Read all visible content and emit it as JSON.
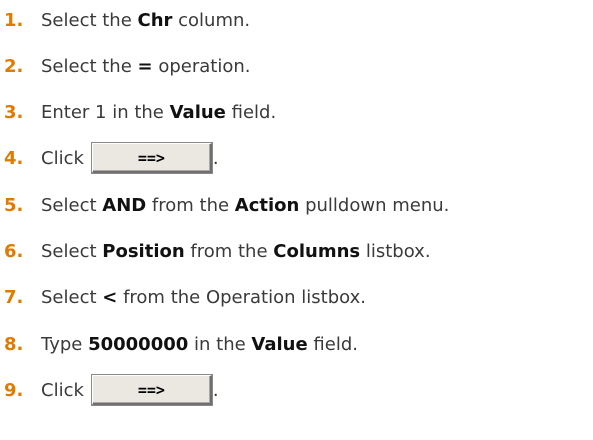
{
  "steps": [
    {
      "num": "1.",
      "parts": [
        {
          "t": "Select the "
        },
        {
          "t": "Chr",
          "b": true
        },
        {
          "t": " column."
        }
      ]
    },
    {
      "num": "2.",
      "parts": [
        {
          "t": "Select the "
        },
        {
          "t": "=",
          "b": true
        },
        {
          "t": " operation."
        }
      ]
    },
    {
      "num": "3.",
      "parts": [
        {
          "t": "Enter 1 in the "
        },
        {
          "t": "Value",
          "b": true
        },
        {
          "t": " field."
        }
      ]
    },
    {
      "num": "4.",
      "parts": [
        {
          "t": "Click"
        }
      ],
      "button": "==>",
      "after": "."
    },
    {
      "num": "5.",
      "parts": [
        {
          "t": "Select "
        },
        {
          "t": "AND",
          "b": true
        },
        {
          "t": " from the "
        },
        {
          "t": "Action",
          "b": true
        },
        {
          "t": " pulldown menu."
        }
      ]
    },
    {
      "num": "6.",
      "parts": [
        {
          "t": "Select "
        },
        {
          "t": "Position",
          "b": true
        },
        {
          "t": " from the "
        },
        {
          "t": "Columns",
          "b": true
        },
        {
          "t": " listbox."
        }
      ]
    },
    {
      "num": "7.",
      "parts": [
        {
          "t": "Select "
        },
        {
          "t": "<",
          "b": true
        },
        {
          "t": " from the Operation listbox."
        }
      ]
    },
    {
      "num": "8.",
      "parts": [
        {
          "t": "Type "
        },
        {
          "t": "50000000",
          "b": true
        },
        {
          "t": " in the "
        },
        {
          "t": "Value",
          "b": true
        },
        {
          "t": " field."
        }
      ]
    },
    {
      "num": "9.",
      "parts": [
        {
          "t": "Click"
        }
      ],
      "button": "==>",
      "after": "."
    }
  ]
}
